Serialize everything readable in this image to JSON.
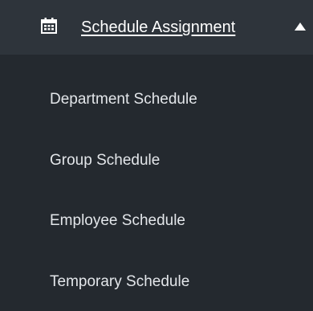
{
  "colors": {
    "header_bg": "#2e343b",
    "menu_bg": "#24292f",
    "header_text": "#ffffff",
    "item_text": "#e3e6ea"
  },
  "header": {
    "icon": "calendar-icon",
    "title": "Schedule Assignment",
    "toggle_icon": "caret-up-icon"
  },
  "menu": {
    "items": [
      {
        "label": "Department Schedule"
      },
      {
        "label": "Group Schedule"
      },
      {
        "label": "Employee Schedule"
      },
      {
        "label": "Temporary Schedule"
      }
    ]
  }
}
